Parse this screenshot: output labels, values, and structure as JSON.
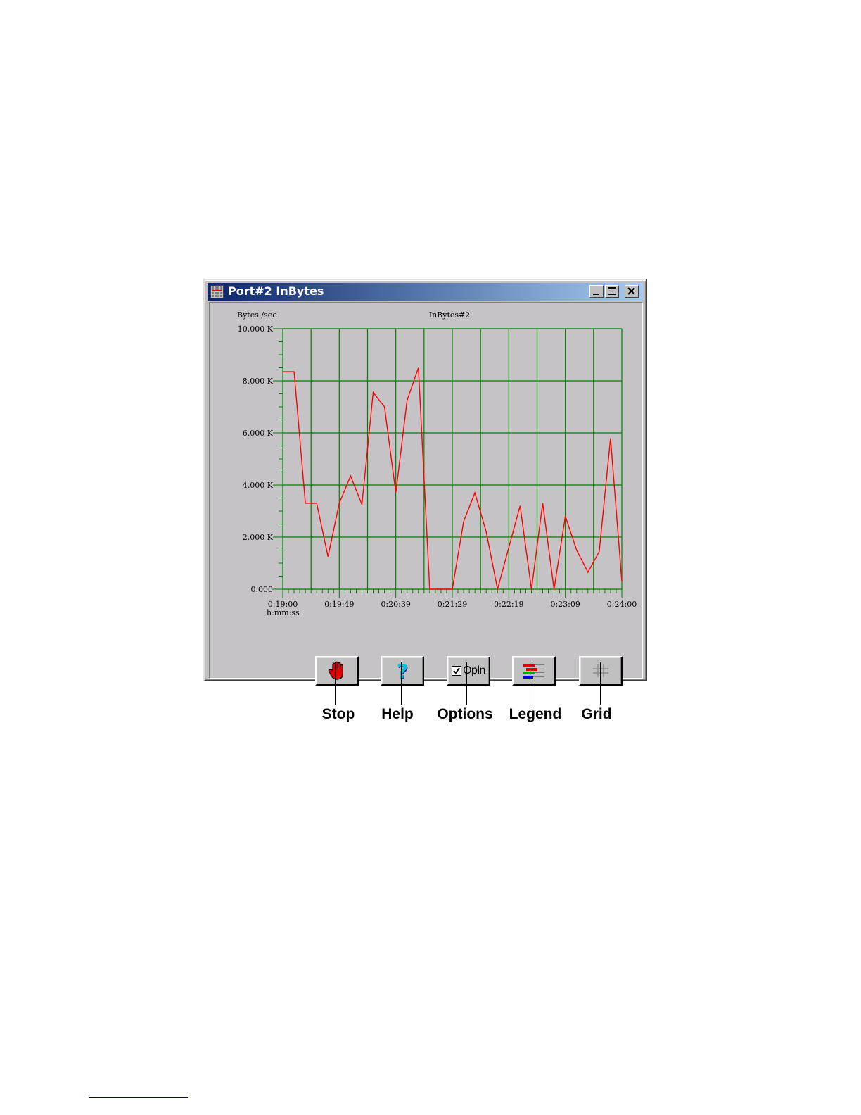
{
  "window": {
    "title": "Port#2 InBytes",
    "controls": [
      "minimize",
      "maximize",
      "close"
    ]
  },
  "chart_data": {
    "type": "line",
    "title": "InBytes#2",
    "ylabel": "Bytes /sec",
    "xlabel": "h:mm:ss",
    "ylim": [
      0,
      10000
    ],
    "yticks": [
      {
        "value": 0,
        "label": "0.000"
      },
      {
        "value": 2000,
        "label": "2.000 K"
      },
      {
        "value": 4000,
        "label": "4.000 K"
      },
      {
        "value": 6000,
        "label": "6.000 K"
      },
      {
        "value": 8000,
        "label": "8.000 K"
      },
      {
        "value": 10000,
        "label": "10.000 K"
      }
    ],
    "xlim": [
      "0:19:00",
      "0:24:00"
    ],
    "xticks": [
      "0:19:00",
      "0:19:49",
      "0:20:39",
      "0:21:29",
      "0:22:19",
      "0:23:09",
      "0:24:00"
    ],
    "grid": true,
    "series": [
      {
        "color": "#ff0000",
        "x": [
          "0:19:00",
          "0:19:10",
          "0:19:20",
          "0:19:30",
          "0:19:40",
          "0:19:50",
          "0:20:00",
          "0:20:10",
          "0:20:20",
          "0:20:30",
          "0:20:40",
          "0:20:50",
          "0:21:00",
          "0:21:10",
          "0:21:20",
          "0:21:30",
          "0:21:40",
          "0:21:50",
          "0:22:00",
          "0:22:10",
          "0:22:20",
          "0:22:30",
          "0:22:40",
          "0:22:50",
          "0:23:00",
          "0:23:10",
          "0:23:20",
          "0:23:30",
          "0:23:40",
          "0:23:50",
          "0:24:00"
        ],
        "values": [
          8350,
          8350,
          3300,
          3300,
          1250,
          3300,
          4350,
          3250,
          7550,
          7000,
          3700,
          7250,
          8500,
          0,
          0,
          0,
          2600,
          3700,
          2200,
          0,
          1600,
          3200,
          0,
          3300,
          0,
          2800,
          1500,
          650,
          1450,
          5800,
          300
        ]
      }
    ]
  },
  "toolbar": {
    "buttons": [
      {
        "name": "stop",
        "icon": "hand-stop-icon",
        "label": ""
      },
      {
        "name": "help",
        "icon": "question-mark-icon",
        "label": "?"
      },
      {
        "name": "options",
        "icon": "checkbox-icon",
        "label": "Opln"
      },
      {
        "name": "legend",
        "icon": "legend-lines-icon",
        "label": ""
      },
      {
        "name": "grid",
        "icon": "grid-icon",
        "label": ""
      }
    ]
  },
  "callouts": {
    "stop": "Stop",
    "help": "Help",
    "options": "Options",
    "legend": "Legend",
    "grid": "Grid"
  }
}
